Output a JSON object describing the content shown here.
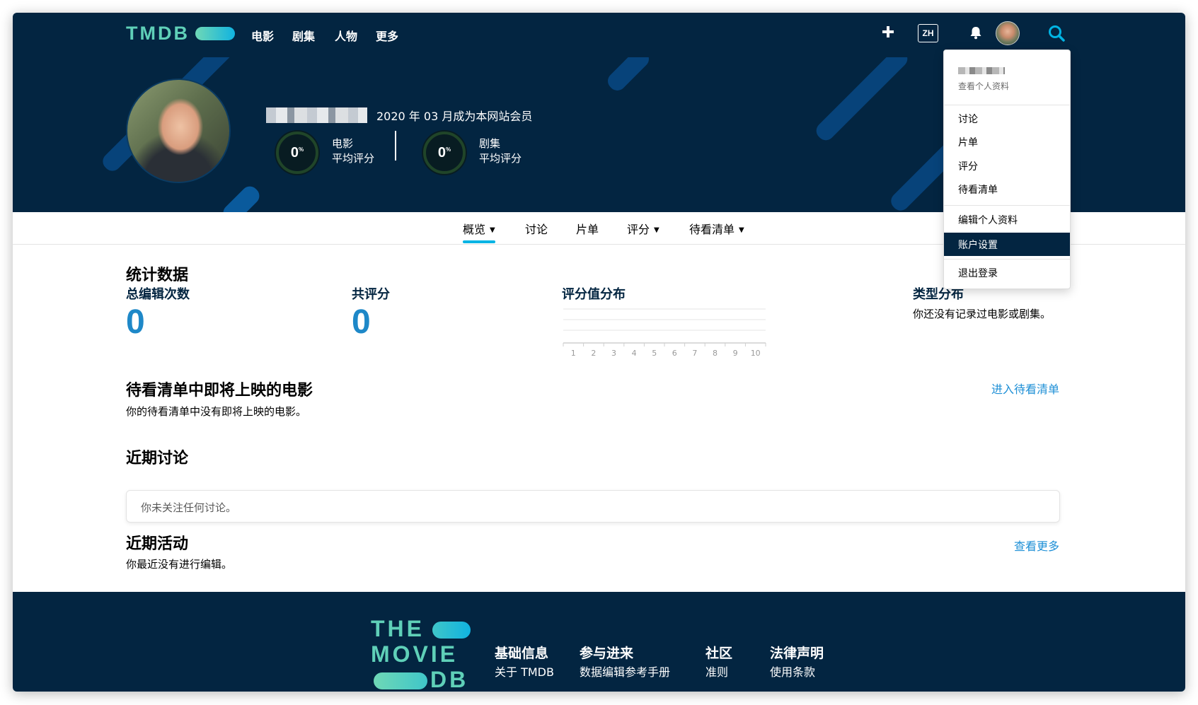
{
  "nav": {
    "logo": "TMDB",
    "items": [
      "电影",
      "剧集",
      "人物",
      "更多"
    ],
    "lang": "ZH"
  },
  "profile": {
    "member_since": "2020 年 03 月成为本网站会员",
    "movie_score": "0",
    "movie_label_1": "电影",
    "movie_label_2": "平均评分",
    "tv_score": "0",
    "tv_label_1": "剧集",
    "tv_label_2": "平均评分",
    "pct_symbol": "%"
  },
  "tabs": [
    {
      "label": "概览",
      "caret": "▼"
    },
    {
      "label": "讨论",
      "caret": ""
    },
    {
      "label": "片单",
      "caret": ""
    },
    {
      "label": "评分",
      "caret": "▼"
    },
    {
      "label": "待看清单",
      "caret": "▼"
    }
  ],
  "stats": {
    "title": "统计数据",
    "total_edits_label": "总编辑次数",
    "total_edits_value": "0",
    "total_ratings_label": "共评分",
    "total_ratings_value": "0",
    "rating_dist_label": "评分值分布",
    "genre_dist_label": "类型分布",
    "genre_empty": "你还没有记录过电影或剧集。"
  },
  "chart_data": {
    "type": "bar",
    "categories": [
      "1",
      "2",
      "3",
      "4",
      "5",
      "6",
      "7",
      "8",
      "9",
      "10"
    ],
    "values": [
      0,
      0,
      0,
      0,
      0,
      0,
      0,
      0,
      0,
      0
    ],
    "title": "评分值分布",
    "xlabel": "",
    "ylabel": "",
    "grid": true
  },
  "watchlist": {
    "title": "待看清单中即将上映的电影",
    "empty": "你的待看清单中没有即将上映的电影。",
    "link": "进入待看清单"
  },
  "discussions": {
    "title": "近期讨论",
    "empty": "你未关注任何讨论。"
  },
  "activity": {
    "title": "近期活动",
    "empty": "你最近没有进行编辑。",
    "link": "查看更多"
  },
  "footer": {
    "logo_lines": [
      "THE",
      "MOVIE",
      "DB"
    ],
    "columns": [
      {
        "heading": "基础信息",
        "links": [
          "关于 TMDB"
        ]
      },
      {
        "heading": "参与进来",
        "links": [
          "数据编辑参考手册"
        ]
      },
      {
        "heading": "社区",
        "links": [
          "准则"
        ]
      },
      {
        "heading": "法律声明",
        "links": [
          "使用条款"
        ]
      }
    ]
  },
  "dropdown": {
    "view_profile": "查看个人资料",
    "items": [
      "讨论",
      "片单",
      "评分",
      "待看清单"
    ],
    "edit_profile": "编辑个人资料",
    "account_settings": "账户设置",
    "logout": "退出登录"
  },
  "colors": {
    "primary_dark": "#032541",
    "accent_blue": "#01b4e4",
    "accent_green": "#90cea1"
  }
}
